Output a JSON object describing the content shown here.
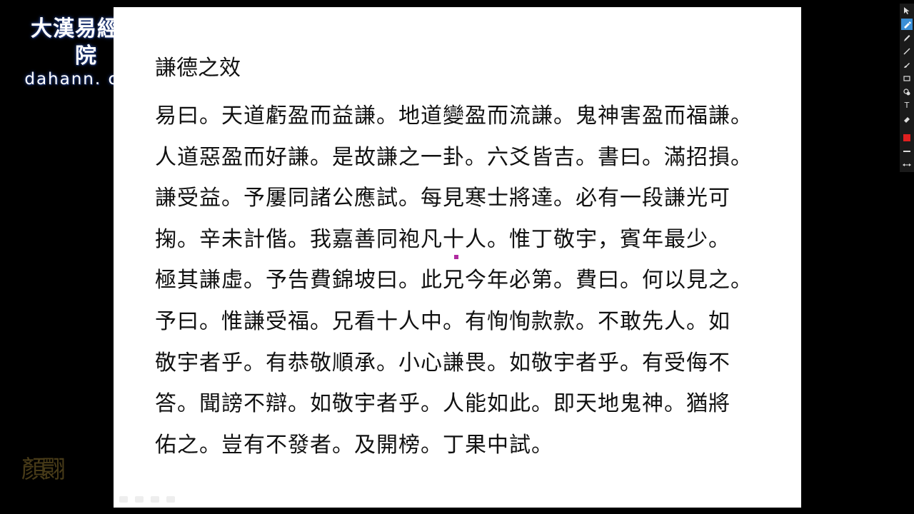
{
  "logo": {
    "chinese": "大漢易經書院",
    "url": "dahann. com"
  },
  "slide": {
    "title": "謙德之效",
    "lines": [
      "易曰。天道虧盈而益謙。地道變盈而流謙。鬼神害盈而福謙。",
      "人道惡盈而好謙。是故謙之一卦。六爻皆吉。書曰。滿招損。",
      "謙受益。予屢同諸公應試。每見寒士將達。必有一段謙光可",
      "掬。辛未計偕。我嘉善同袍凡十人。惟丁敬宇，賓年最少。",
      "極其謙虛。予告費錦坡曰。此兄今年必第。費曰。何以見之。",
      "予曰。惟謙受福。兄看十人中。有恂恂款款。不敢先人。如",
      "敬宇者乎。有恭敬順承。小心謙畏。如敬宇者乎。有受侮不",
      "答。聞謗不辯。如敬宇者乎。人能如此。即天地鬼神。猶將",
      "佑之。豈有不發者。及開榜。丁果中試。"
    ]
  },
  "watermark": "顏翾",
  "toolbar": {
    "tools": [
      "pointer-icon",
      "highlighter-icon",
      "pen-icon",
      "line-icon",
      "brush-icon",
      "rectangle-icon",
      "stamp-icon",
      "text-tool-icon",
      "eraser-icon",
      "color-swatch",
      "line-width-icon",
      "expand-icon"
    ],
    "text_tool_glyph": "T",
    "active_color": "#e02020"
  }
}
